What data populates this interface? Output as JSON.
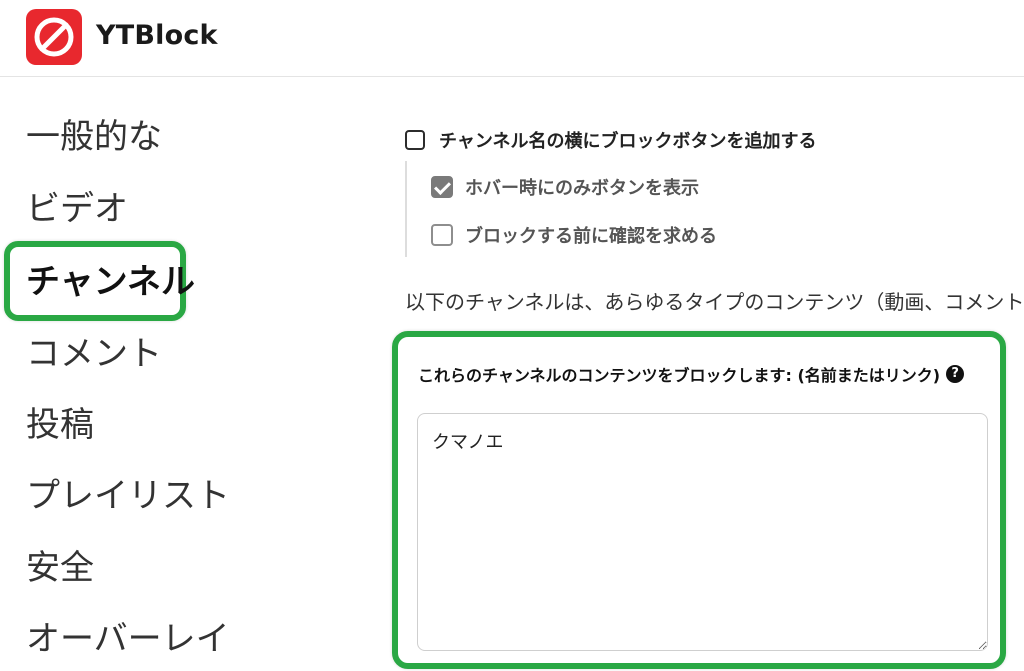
{
  "app": {
    "title": "YTBlock"
  },
  "colors": {
    "brand": "#e8282e",
    "highlight": "#2aa844"
  },
  "nav": {
    "items": [
      {
        "label": "一般的な",
        "active": false
      },
      {
        "label": "ビデオ",
        "active": false
      },
      {
        "label": "チャンネル",
        "active": true
      },
      {
        "label": "コメント",
        "active": false
      },
      {
        "label": "投稿",
        "active": false
      },
      {
        "label": "プレイリスト",
        "active": false
      },
      {
        "label": "安全",
        "active": false
      },
      {
        "label": "オーバーレイ",
        "active": false
      }
    ]
  },
  "options": {
    "add_block_button": {
      "label": "チャンネル名の横にブロックボタンを追加する",
      "checked": false
    },
    "show_on_hover": {
      "label": "ホバー時にのみボタンを表示",
      "checked": true
    },
    "confirm_before_block": {
      "label": "ブロックする前に確認を求める",
      "checked": false
    }
  },
  "description": "以下のチャンネルは、あらゆるタイプのコンテンツ（動画、コメント、投",
  "block_list": {
    "label": "これらのチャンネルのコンテンツをブロックします: (名前またはリンク)",
    "help_icon": "question-circle-icon",
    "value": "クマノエ"
  }
}
